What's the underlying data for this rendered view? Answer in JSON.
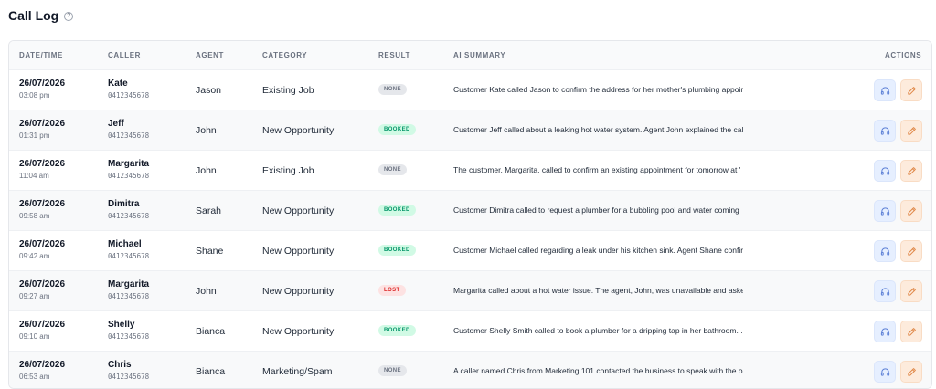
{
  "header": {
    "title": "Call Log",
    "help_icon": "help-circle-icon"
  },
  "columns": {
    "datetime": "DATE/TIME",
    "caller": "CALLER",
    "agent": "AGENT",
    "category": "CATEGORY",
    "result": "RESULT",
    "summary": "AI SUMMARY",
    "actions": "ACTIONS"
  },
  "colors": {
    "listen_button_bg": "#e6efff",
    "edit_button_bg": "#fdebdc",
    "booked": "#059669",
    "lost": "#dc2626",
    "none": "#6b7280"
  },
  "rows": [
    {
      "date": "26/07/2026",
      "time": "03:08 pm",
      "caller": "Kate",
      "phone": "0412345678",
      "agent": "Jason",
      "category": "Existing Job",
      "result": "NONE",
      "result_type": "none",
      "summary": "Customer Kate called Jason to confirm the address for her mother's plumbing appoir"
    },
    {
      "date": "26/07/2026",
      "time": "01:31 pm",
      "caller": "Jeff",
      "phone": "0412345678",
      "agent": "John",
      "category": "New Opportunity",
      "result": "BOOKED",
      "result_type": "booked",
      "summary": "Customer Jeff called about a leaking hot water system. Agent John explained the call"
    },
    {
      "date": "26/07/2026",
      "time": "11:04 am",
      "caller": "Margarita",
      "phone": "0412345678",
      "agent": "John",
      "category": "Existing Job",
      "result": "NONE",
      "result_type": "none",
      "summary": "The customer, Margarita, called to confirm an existing appointment for tomorrow at '"
    },
    {
      "date": "26/07/2026",
      "time": "09:58 am",
      "caller": "Dimitra",
      "phone": "0412345678",
      "agent": "Sarah",
      "category": "New Opportunity",
      "result": "BOOKED",
      "result_type": "booked",
      "summary": "Customer Dimitra called to request a plumber for a bubbling pool and water coming"
    },
    {
      "date": "26/07/2026",
      "time": "09:42 am",
      "caller": "Michael",
      "phone": "0412345678",
      "agent": "Shane",
      "category": "New Opportunity",
      "result": "BOOKED",
      "result_type": "booked",
      "summary": "Customer Michael called regarding a leak under his kitchen sink. Agent Shane confir"
    },
    {
      "date": "26/07/2026",
      "time": "09:27 am",
      "caller": "Margarita",
      "phone": "0412345678",
      "agent": "John",
      "category": "New Opportunity",
      "result": "LOST",
      "result_type": "lost",
      "summary": "Margarita called about a hot water issue. The agent, John, was unavailable and asked"
    },
    {
      "date": "26/07/2026",
      "time": "09:10 am",
      "caller": "Shelly",
      "phone": "0412345678",
      "agent": "Bianca",
      "category": "New Opportunity",
      "result": "BOOKED",
      "result_type": "booked",
      "summary": "Customer Shelly Smith called to book a plumber for a dripping tap in her bathroom. ."
    },
    {
      "date": "26/07/2026",
      "time": "06:53 am",
      "caller": "Chris",
      "phone": "0412345678",
      "agent": "Bianca",
      "category": "Marketing/Spam",
      "result": "NONE",
      "result_type": "none",
      "summary": "A caller named Chris from Marketing 101 contacted the business to speak with the o"
    }
  ]
}
